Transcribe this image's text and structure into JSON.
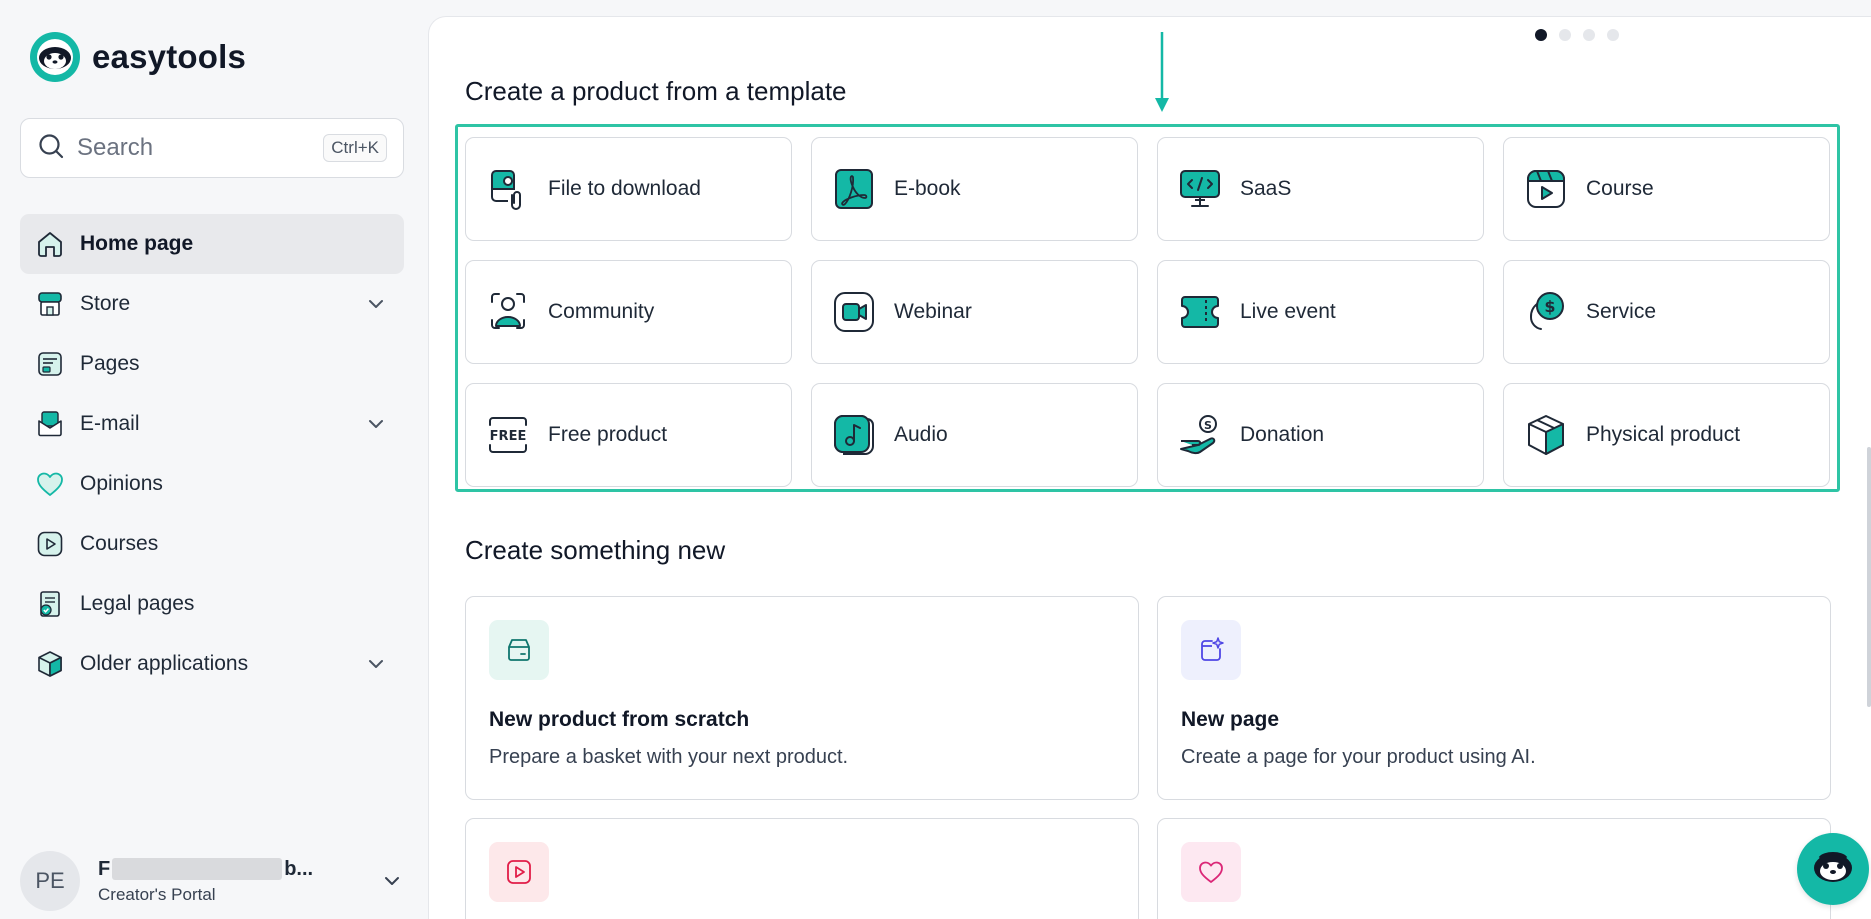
{
  "brand": {
    "name": "easytools",
    "accent": "#14b8a6"
  },
  "search": {
    "placeholder": "Search",
    "shortcut": "Ctrl+K"
  },
  "sidebar": {
    "items": [
      {
        "label": "Home page",
        "icon": "home-icon",
        "active": true,
        "expandable": false
      },
      {
        "label": "Store",
        "icon": "store-icon",
        "active": false,
        "expandable": true
      },
      {
        "label": "Pages",
        "icon": "pages-icon",
        "active": false,
        "expandable": false
      },
      {
        "label": "E-mail",
        "icon": "mail-icon",
        "active": false,
        "expandable": true
      },
      {
        "label": "Opinions",
        "icon": "heart-icon",
        "active": false,
        "expandable": false
      },
      {
        "label": "Courses",
        "icon": "play-icon",
        "active": false,
        "expandable": false
      },
      {
        "label": "Legal pages",
        "icon": "legal-icon",
        "active": false,
        "expandable": false
      },
      {
        "label": "Older applications",
        "icon": "box-icon",
        "active": false,
        "expandable": true
      }
    ]
  },
  "user": {
    "initials": "PE",
    "name_start": "F",
    "name_end": "b...",
    "subtitle": "Creator's Portal"
  },
  "carousel": {
    "count": 4,
    "active": 0
  },
  "templates": {
    "title": "Create a product from a template",
    "items": [
      {
        "label": "File to download",
        "icon": "file-download-icon"
      },
      {
        "label": "E-book",
        "icon": "pdf-icon"
      },
      {
        "label": "SaaS",
        "icon": "monitor-code-icon"
      },
      {
        "label": "Course",
        "icon": "course-video-icon"
      },
      {
        "label": "Community",
        "icon": "community-icon"
      },
      {
        "label": "Webinar",
        "icon": "webinar-camera-icon"
      },
      {
        "label": "Live event",
        "icon": "ticket-icon"
      },
      {
        "label": "Service",
        "icon": "service-dollar-icon"
      },
      {
        "label": "Free product",
        "icon": "free-icon"
      },
      {
        "label": "Audio",
        "icon": "music-note-icon"
      },
      {
        "label": "Donation",
        "icon": "donation-hand-icon"
      },
      {
        "label": "Physical product",
        "icon": "package-icon"
      }
    ],
    "free_icon_text": "FREE"
  },
  "create_new": {
    "title": "Create something new",
    "items": [
      {
        "title": "New product from scratch",
        "desc": "Prepare a basket with your next product.",
        "icon": "basket-icon",
        "color": "#e6f6f2"
      },
      {
        "title": "New page",
        "desc": "Create a page for your product using AI.",
        "icon": "ai-page-icon",
        "color": "#eef0fd"
      },
      {
        "title": "",
        "desc": "",
        "icon": "play-icon",
        "color": "#fde8ea"
      },
      {
        "title": "",
        "desc": "",
        "icon": "heart-icon",
        "color": "#fde8f1"
      }
    ]
  }
}
